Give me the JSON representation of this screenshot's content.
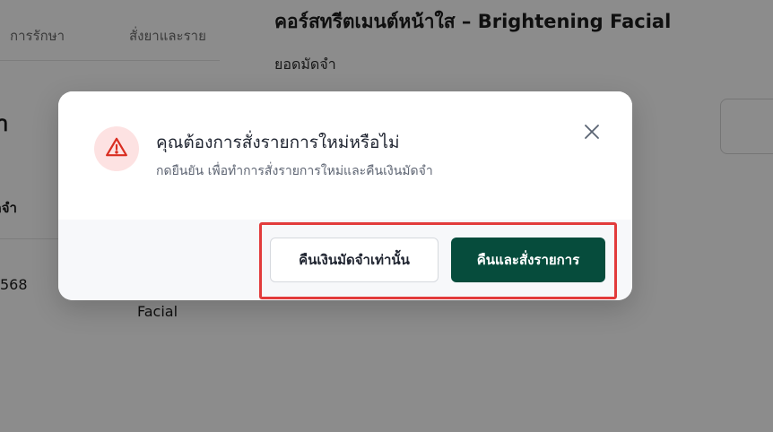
{
  "background": {
    "tabs": [
      {
        "label": "การรักษา"
      },
      {
        "label": "สั่งยาและราย"
      }
    ],
    "left_heading": "า",
    "table_header": "ดจำ",
    "row_value": "568",
    "row_name": "Facial"
  },
  "drawer": {
    "title": "คอร์สทรีตเมนต์หน้าใส – Brightening Facial",
    "deposit_label": "ยอดมัดจำ"
  },
  "modal": {
    "title": "คุณต้องการสั่งรายการใหม่หรือไม่",
    "description": "กดยืนยัน เพื่อทำการสั่งรายการใหม่และคืนเงินมัดจำ",
    "icon": "warning-triangle-icon",
    "secondary_button": "คืนเงินมัดจำเท่านั้น",
    "primary_button": "คืนและสั่งรายการ",
    "colors": {
      "primary": "#064c3c",
      "warning_bg": "#fde2e2",
      "warning_icon": "#d92d20",
      "highlight": "#e23b3b"
    }
  }
}
